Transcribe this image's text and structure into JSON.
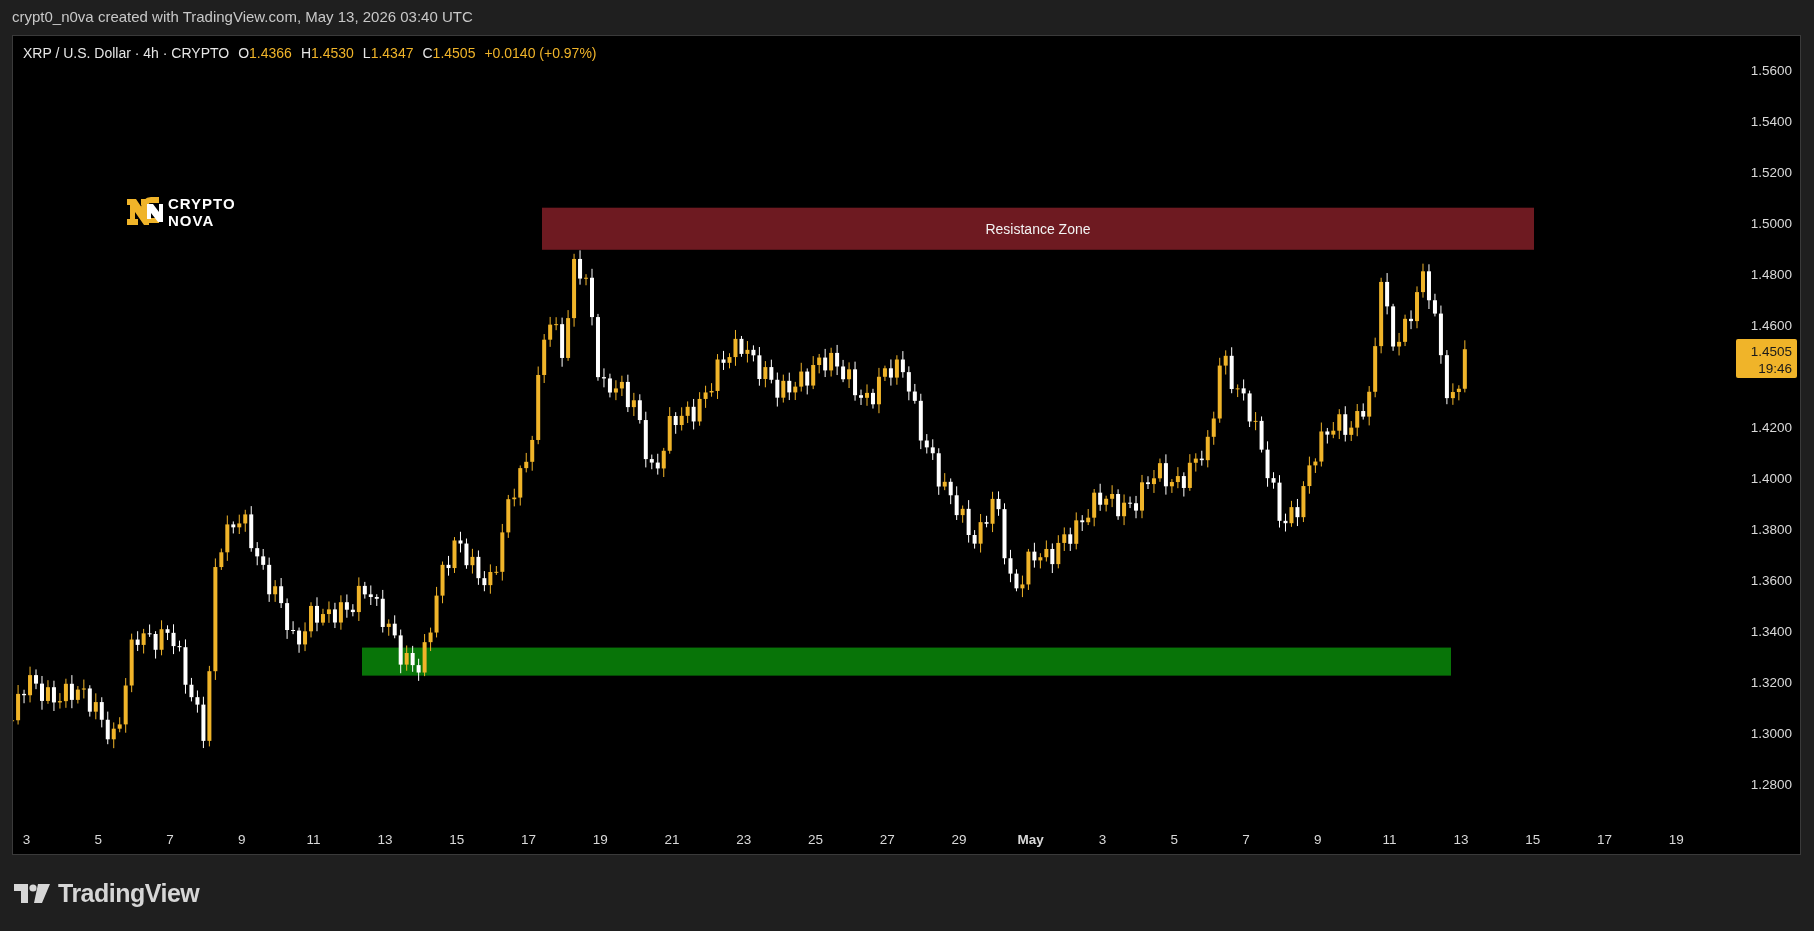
{
  "caption": "crypt0_n0va created with TradingView.com, May 13, 2026 03:40 UTC",
  "legend": {
    "symbol": "XRP / U.S. Dollar · 4h · CRYPTO",
    "ohlc": [
      {
        "label": "O",
        "value": "1.4366"
      },
      {
        "label": "H",
        "value": "1.4530"
      },
      {
        "label": "L",
        "value": "1.4347"
      },
      {
        "label": "C",
        "value": "1.4505"
      }
    ],
    "change": "+0.0140 (+0.97%)"
  },
  "watermark_logo": {
    "line_1": "CRYPTO",
    "line_2": "NOVA"
  },
  "zones": [
    {
      "kind": "resistance",
      "label": "Resistance Zone",
      "color": "#6e1a21"
    },
    {
      "kind": "support",
      "color": "#087408"
    }
  ],
  "price_axis": [
    "1.5600",
    "1.5400",
    "1.5200",
    "1.5000",
    "1.4800",
    "1.4600",
    "1.4200",
    "1.4000",
    "1.3800",
    "1.3600",
    "1.3400",
    "1.3200",
    "1.3000",
    "1.2800"
  ],
  "price_tag": {
    "price": "1.4505",
    "countdown": "19:46"
  },
  "time_axis": [
    {
      "label": "3",
      "kind": "day"
    },
    {
      "label": "5",
      "kind": "day"
    },
    {
      "label": "7",
      "kind": "day"
    },
    {
      "label": "9",
      "kind": "day"
    },
    {
      "label": "11",
      "kind": "day"
    },
    {
      "label": "13",
      "kind": "day"
    },
    {
      "label": "15",
      "kind": "day"
    },
    {
      "label": "17",
      "kind": "day"
    },
    {
      "label": "19",
      "kind": "day"
    },
    {
      "label": "21",
      "kind": "day"
    },
    {
      "label": "23",
      "kind": "day"
    },
    {
      "label": "25",
      "kind": "day"
    },
    {
      "label": "27",
      "kind": "day"
    },
    {
      "label": "29",
      "kind": "day"
    },
    {
      "label": "May",
      "kind": "month"
    },
    {
      "label": "3",
      "kind": "day"
    },
    {
      "label": "5",
      "kind": "day"
    },
    {
      "label": "7",
      "kind": "day"
    },
    {
      "label": "9",
      "kind": "day"
    },
    {
      "label": "11",
      "kind": "day"
    },
    {
      "label": "13",
      "kind": "day"
    },
    {
      "label": "15",
      "kind": "day"
    },
    {
      "label": "17",
      "kind": "day"
    },
    {
      "label": "19",
      "kind": "day"
    }
  ],
  "footer": {
    "brand": "TradingView"
  }
}
